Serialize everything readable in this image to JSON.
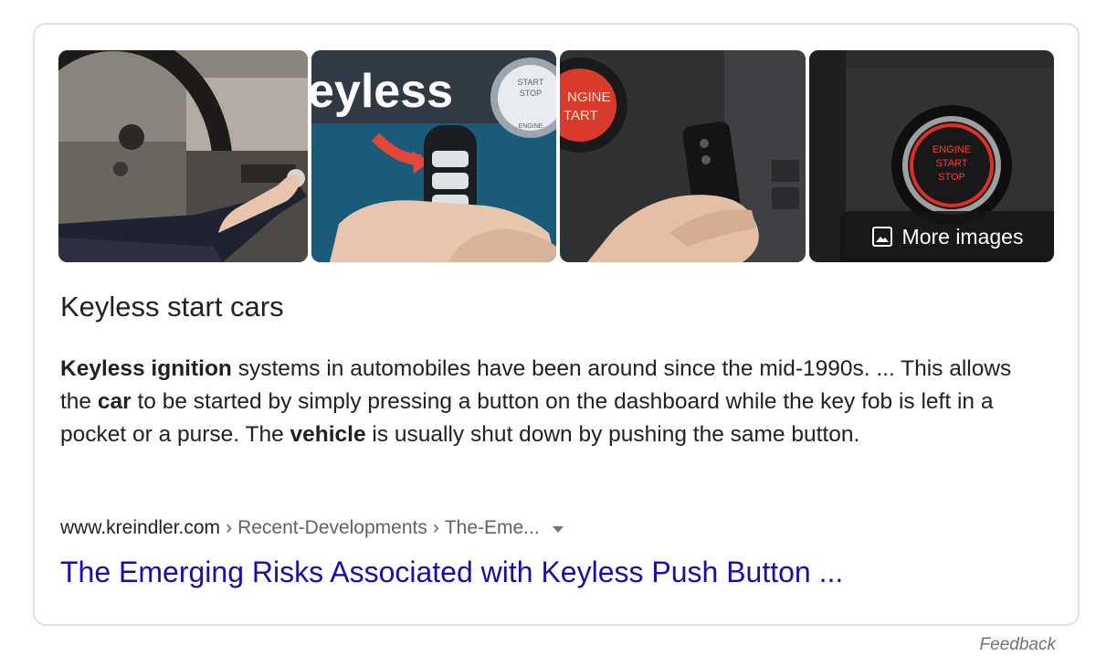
{
  "more_images": {
    "label": "More images",
    "icon": "image-icon"
  },
  "thumbnails": [
    {
      "icon": "car-dashboard-photo"
    },
    {
      "icon": "keyless-fob-photo",
      "overlay_text": "eyless",
      "button_text": [
        "START",
        "STOP",
        "ENGINE"
      ]
    },
    {
      "icon": "engine-start-hand-photo",
      "button_text": [
        "NGINE",
        "TART"
      ]
    },
    {
      "icon": "engine-start-stop-button-photo",
      "button_text": [
        "ENGINE",
        "START",
        "STOP"
      ]
    }
  ],
  "title": "Keyless start cars",
  "description": {
    "bold1": "Keyless ignition",
    "text1": " systems in automobiles have been around since the mid-1990s. ... This allows the ",
    "bold2": "car",
    "text2": " to be started by simply pressing a button on the dashboard while the key fob is left in a pocket or a purse. The ",
    "bold3": "vehicle",
    "text3": " is usually shut down by pushing the same button."
  },
  "cite": {
    "domain": "www.kreindler.com",
    "separator": "›",
    "path1": "Recent-Developments",
    "path2": "The-Eme..."
  },
  "result_link": "The Emerging Risks Associated with Keyless Push Button ...",
  "feedback": "Feedback",
  "colors": {
    "link": "#1a0dab",
    "text": "#202124",
    "muted": "#70757a",
    "border": "#dfe1e5"
  }
}
